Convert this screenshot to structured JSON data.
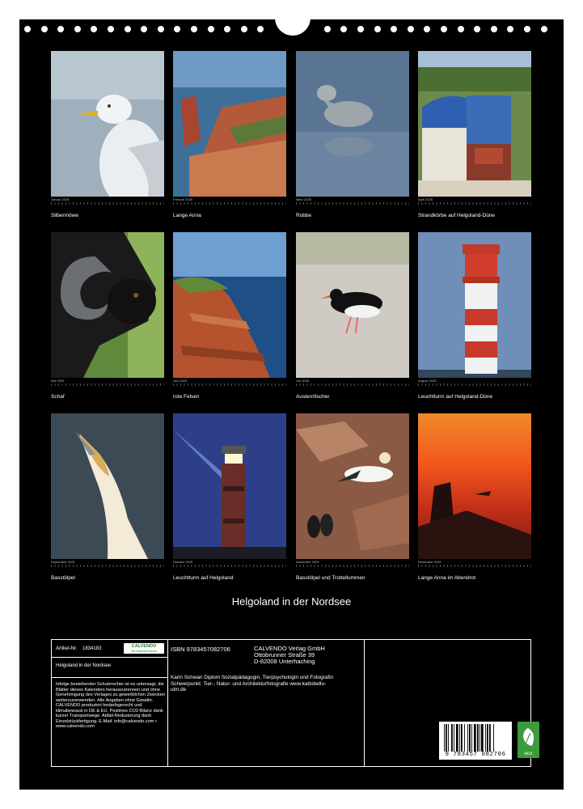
{
  "calendar": {
    "title": "Helgoland in der Nordsee",
    "months": [
      {
        "month": "Januar 2025",
        "caption": "Silbermöwe"
      },
      {
        "month": "Februar 2025",
        "caption": "Lange Anna"
      },
      {
        "month": "März 2025",
        "caption": "Robbe"
      },
      {
        "month": "April 2025",
        "caption": "Strandkörbe auf Helgoland-Düne"
      },
      {
        "month": "Mai 2025",
        "caption": "Schaf"
      },
      {
        "month": "Juni 2025",
        "caption": "rote Felsen"
      },
      {
        "month": "Juli 2025",
        "caption": "Austernfischer"
      },
      {
        "month": "August 2025",
        "caption": "Leuchtturm auf Helgoland-Düne"
      },
      {
        "month": "September 2025",
        "caption": "Basstölpel"
      },
      {
        "month": "Oktober 2025",
        "caption": "Leuchtturm auf Helgoland"
      },
      {
        "month": "November 2025",
        "caption": "Basstölpel und Trottellummen"
      },
      {
        "month": "Dezember 2025",
        "caption": "Lange Anna im Abendrot"
      }
    ]
  },
  "info": {
    "article_label": "Artikel-Nr.",
    "article_no": "1834183",
    "logo": "CALVENDO",
    "logo_sub": "Die Kalendermacher",
    "product_title": "Helgoland in der Nordsee",
    "legal_text": "Infolge bestehender Schutzrechte ist es untersagt, die Blätter dieses Kalenders herauszutrennen und ohne Genehmigung des Verlages zu gewerblichen Zwecken weiterzuverwenden. Alle Angaben ohne Gewähr. CALVENDO produziert bedarfsgerecht und klimabewusst in DE & EU. Positives CO2-Bilanz dank kurzer Transportwege. Abfall-Reduzierung dank Einzelstückfertigung. E-Mail: info@calvendo.com • www.calvendo.com",
    "isbn": "ISBN 9783457082706",
    "publisher": [
      "CALVENDO Verlag GmbH",
      "Ottobrunner Straße 39",
      "D-82008 Unterhaching"
    ],
    "author": "Karin Schwan Diplom Sozialpädagogin, Tierpsychologin und Fotografin Schwerpunkt: Tier-, Natur- und Architekturfotografie www.kattobello-ulm.de",
    "barcode_number": "9 783457 082706",
    "eco_label": "eco"
  }
}
